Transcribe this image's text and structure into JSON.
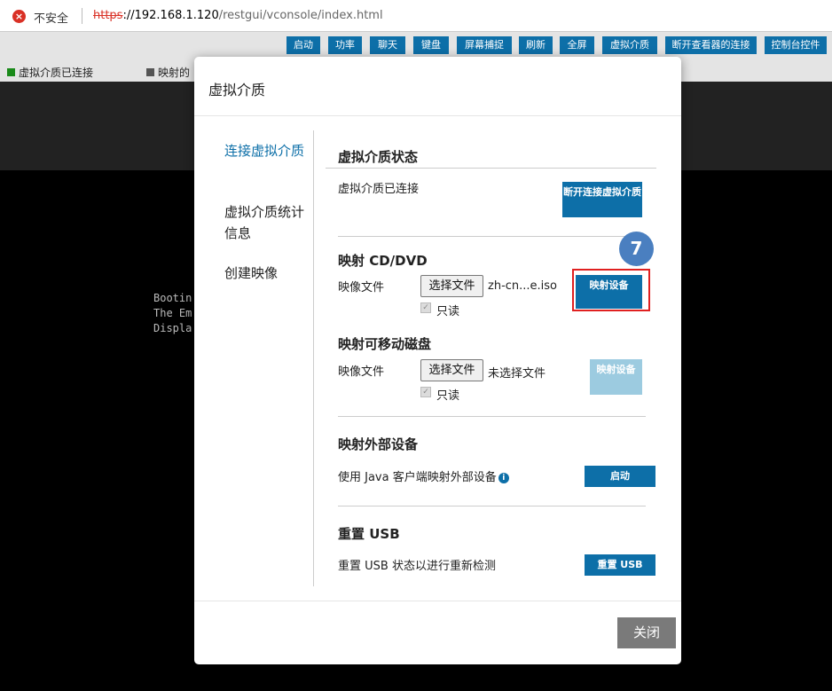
{
  "browser": {
    "security_label": "不安全",
    "url_scheme": "https",
    "url_host": "://192.168.1.120",
    "url_path": "/restgui/vconsole/index.html"
  },
  "toolbar": {
    "buttons": [
      "启动",
      "功率",
      "聊天",
      "键盘",
      "屏幕捕捉",
      "刷新",
      "全屏",
      "虚拟介质",
      "断开查看器的连接",
      "控制台控件"
    ]
  },
  "status": {
    "connected": "虚拟介质已连接",
    "mapped": "映射的"
  },
  "console": {
    "line1": "Bootin",
    "line2": "The Em",
    "line3": "Displa"
  },
  "modal": {
    "title": "虚拟介质",
    "nav": [
      "连接虚拟介质",
      "虚拟介质统计信息",
      "创建映像"
    ],
    "status_section": {
      "title": "虚拟介质状态",
      "text": "虚拟介质已连接",
      "button": "断开连接虚拟介质"
    },
    "cd_section": {
      "title": "映射 CD/DVD",
      "label": "映像文件",
      "choose": "选择文件",
      "file": "zh-cn...e.iso",
      "readonly": "只读",
      "button": "映射设备"
    },
    "removable_section": {
      "title": "映射可移动磁盘",
      "label": "映像文件",
      "choose": "选择文件",
      "file": "未选择文件",
      "readonly": "只读",
      "button": "映射设备"
    },
    "external_section": {
      "title": "映射外部设备",
      "text": "使用 Java 客户端映射外部设备",
      "button": "启动"
    },
    "usb_section": {
      "title": "重置 USB",
      "text": "重置 USB 状态以进行重新检测",
      "button": "重置 USB"
    },
    "close": "关闭",
    "callout": "7"
  },
  "icons": {
    "error": "error-icon",
    "info": "info-icon",
    "check": "checkbox-icon"
  },
  "colors": {
    "accent": "#0d6fa8",
    "disabled": "#9ccbe0",
    "callout_ring": "#e02020",
    "callout_badge": "#4a7fc0",
    "status_connected": "#1a8a1a",
    "status_mapped": "#555555"
  }
}
